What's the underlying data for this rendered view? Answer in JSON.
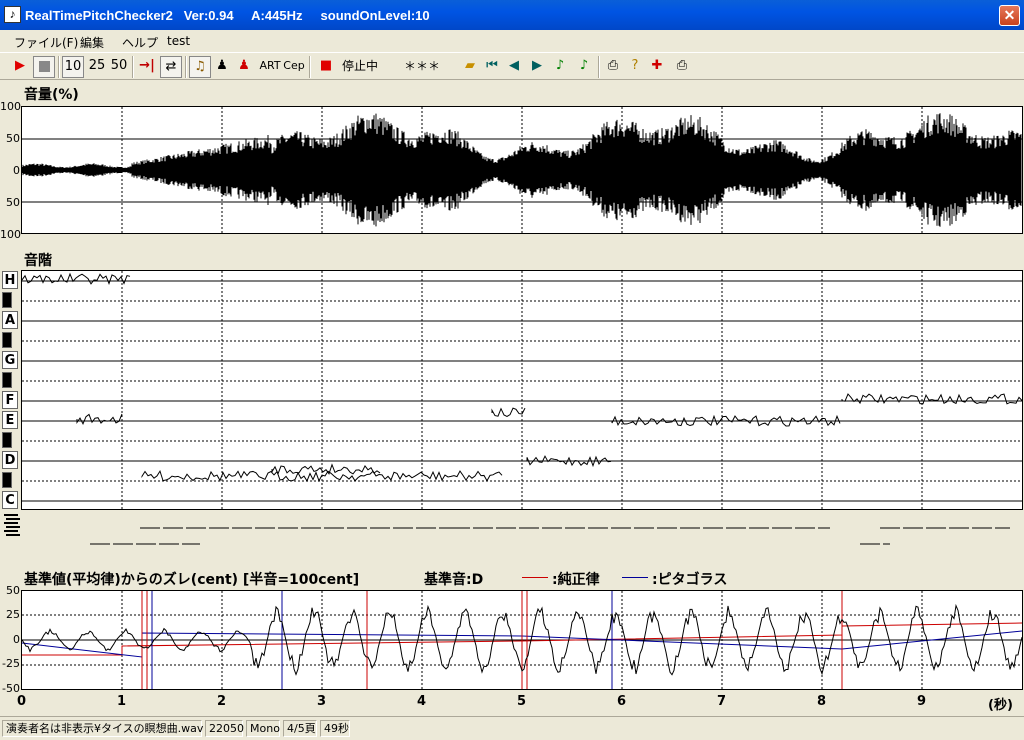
{
  "window": {
    "title": "RealTimePitchChecker2   Ver:0.94     A:445Hz     soundOnLevel:10",
    "close_glyph": "✕"
  },
  "menu": {
    "items": [
      "ファイル(F)",
      "編集",
      "ヘルプ",
      "test"
    ]
  },
  "toolbar": {
    "speed_10": "10",
    "speed_25": "25",
    "speed_50": "50",
    "art_label": "ART",
    "cep_label": "Cep",
    "stop_status": "停止中",
    "note_display": "＊＊＊"
  },
  "volume": {
    "title": "音量(%)",
    "y_ticks": [
      "100",
      "50",
      "0",
      "50",
      "100"
    ]
  },
  "scale": {
    "title": "音階",
    "notes": [
      "H",
      "A",
      "G",
      "F",
      "E",
      "D",
      "C"
    ]
  },
  "deviation": {
    "title": "基準値(平均律)からのズレ(cent) [半音=100cent]",
    "base_note": "基準音:D",
    "legend_pure": ":純正律",
    "legend_pythagorean": ":ピタゴラス",
    "y_ticks": [
      "50",
      "25",
      "0",
      "-25",
      "-50"
    ],
    "colors": {
      "pure": "#cc0000",
      "pythagorean": "#000099"
    }
  },
  "time_axis": {
    "ticks": [
      "0",
      "1",
      "2",
      "3",
      "4",
      "5",
      "6",
      "7",
      "8",
      "9"
    ],
    "unit": "(秒)"
  },
  "status": {
    "file": "演奏者名は非表示¥タイスの瞑想曲.wav",
    "sample_rate": "22050",
    "channels": "Mono",
    "page": "4/5頁",
    "duration": "49秒"
  }
}
